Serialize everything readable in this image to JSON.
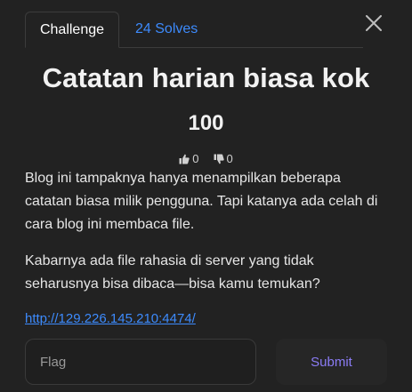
{
  "modal": {
    "close_icon": "close-icon",
    "tabs": [
      {
        "label": "Challenge",
        "active": true
      },
      {
        "label": "24 Solves",
        "active": false
      }
    ],
    "title": "Catatan harian biasa kok",
    "points": "100",
    "votes": {
      "likes": "0",
      "dislikes": "0",
      "like_icon": "thumbs-up-icon",
      "dislike_icon": "thumbs-down-icon"
    },
    "description": [
      "Blog ini tampaknya hanya menampilkan beberapa catatan biasa milik pengguna. Tapi katanya ada celah di cara blog ini membaca file.",
      "Kabarnya ada file rahasia di server yang tidak seharusnya bisa dibaca—bisa kamu temukan?"
    ],
    "link": "http://129.226.145.210:4474/",
    "flag_input": {
      "placeholder": "Flag",
      "value": ""
    },
    "submit_label": "Submit"
  },
  "colors": {
    "background": "#222222",
    "link": "#3d8bfd",
    "submit_text": "#8b7cf6",
    "text": "#ffffff"
  }
}
